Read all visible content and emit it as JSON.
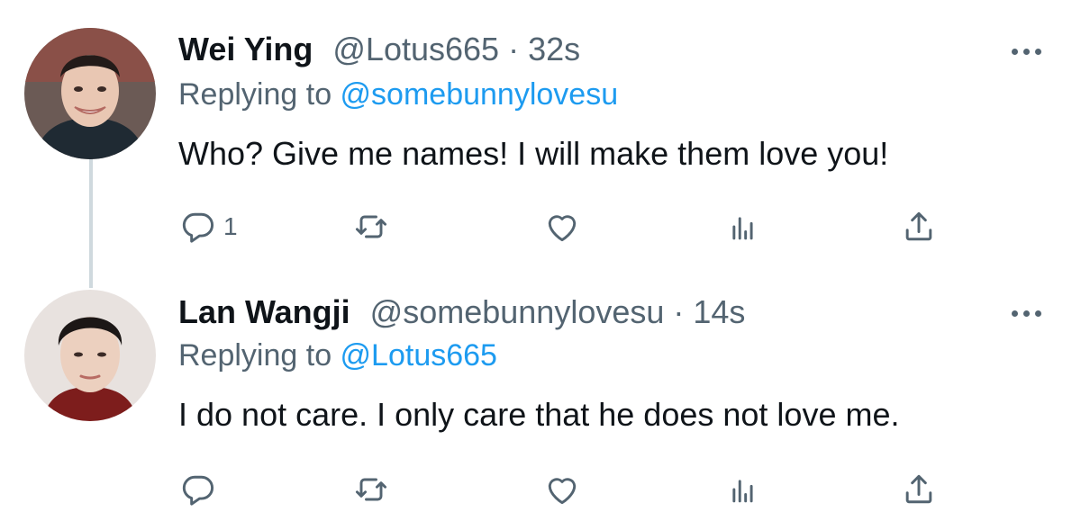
{
  "tweets": [
    {
      "name": "Wei Ying",
      "handle": "@Lotus665",
      "separator": "·",
      "time": "32s",
      "replying_prefix": "Replying to ",
      "replying_to": "@somebunnylovesu",
      "text": "Who? Give me names! I will make them love you!",
      "reply_count": "1"
    },
    {
      "name": "Lan Wangji",
      "handle": "@somebunnylovesu",
      "separator": "·",
      "time": "14s",
      "replying_prefix": "Replying to ",
      "replying_to": "@Lotus665",
      "text": "I do not care. I only care that he does not love me.",
      "reply_count": ""
    }
  ],
  "icons": {
    "reply": "reply-icon",
    "retweet": "retweet-icon",
    "like": "heart-icon",
    "stats": "analytics-icon",
    "share": "share-icon",
    "more": "more-icon"
  },
  "colors": {
    "text": "#0f1419",
    "muted": "#536471",
    "link": "#1d9bf0",
    "thread_line": "#cfd9de"
  }
}
